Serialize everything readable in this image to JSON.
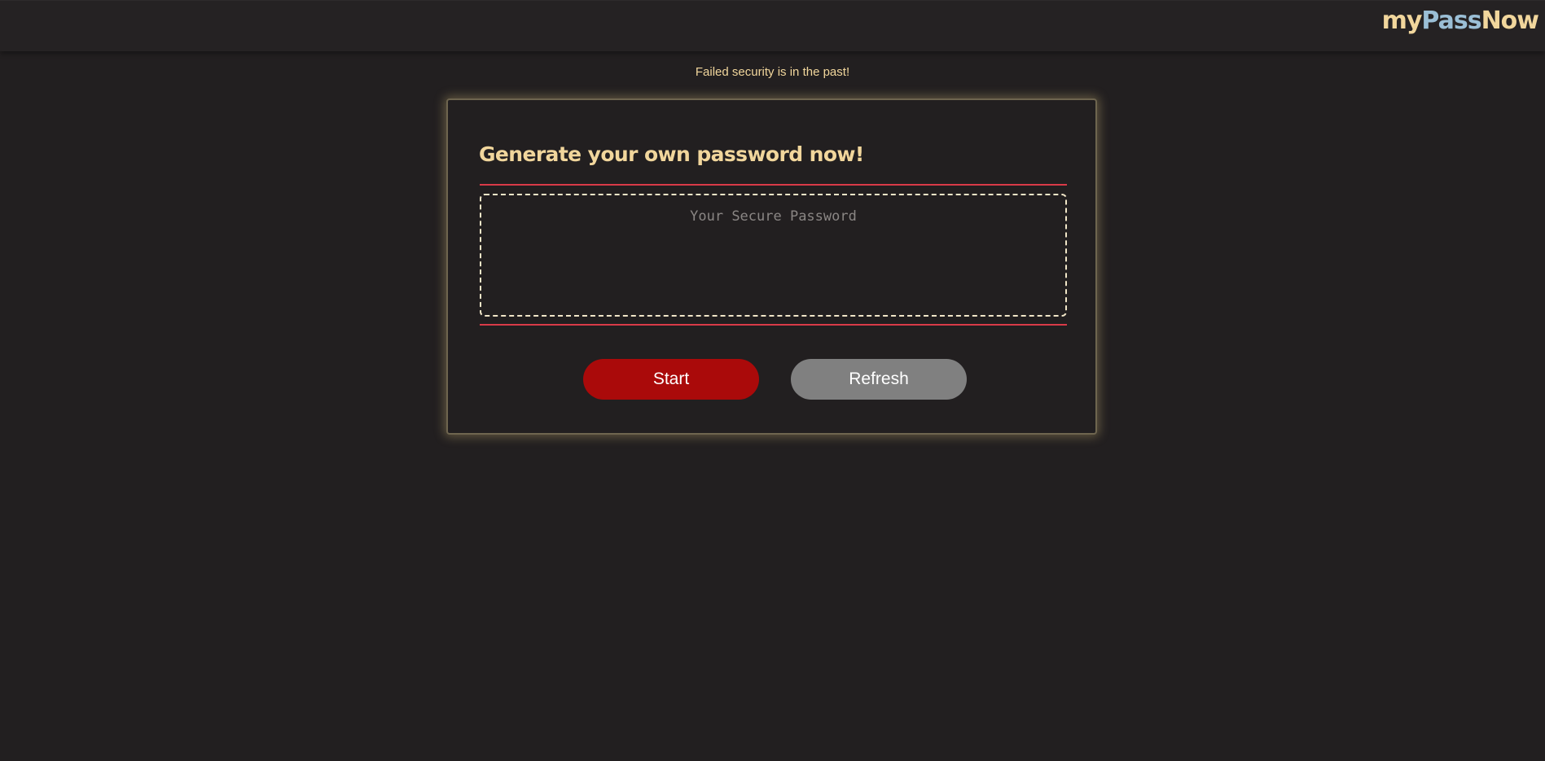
{
  "header": {
    "logo_part_1": "my",
    "logo_part_2": "Pass",
    "logo_part_3": "Now"
  },
  "tagline": "Failed security is in the past!",
  "card": {
    "title": "Generate your own password now!",
    "password_placeholder": "Your Secure Password",
    "password_value": "",
    "start_label": "Start",
    "refresh_label": "Refresh"
  },
  "colors": {
    "background": "#221f20",
    "accent_gold": "#f1d69c",
    "accent_blue": "#9bbfd6",
    "divider_red": "#d93a48",
    "start_button": "#aa0a0a",
    "refresh_button": "#808080"
  }
}
